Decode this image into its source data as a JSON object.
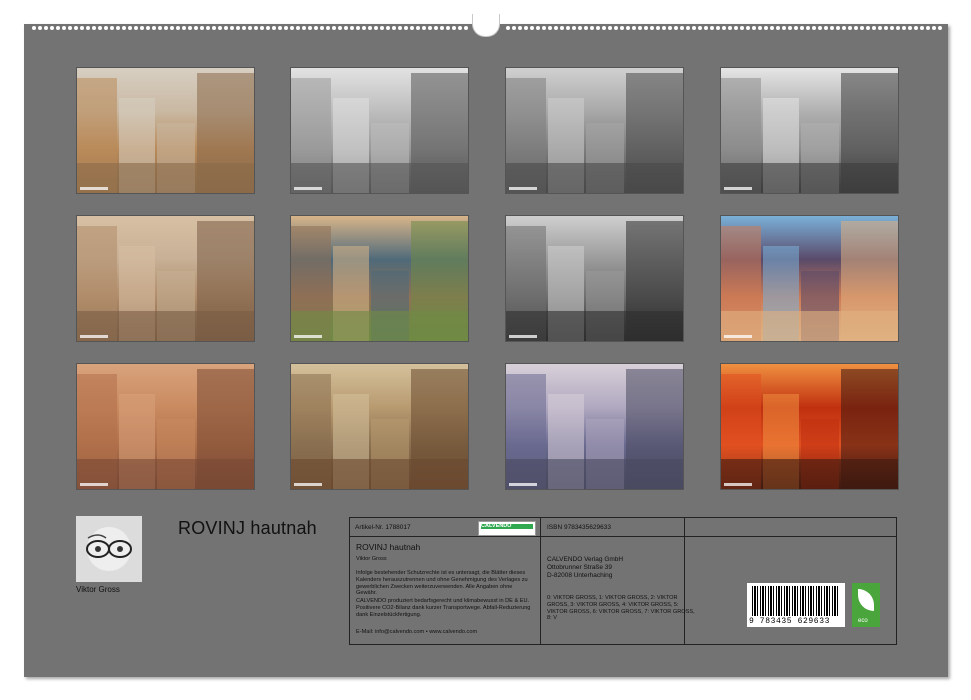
{
  "calendar": {
    "title": "ROVINJ hautnah",
    "author": "Viktor Gross",
    "thumbnails": [
      {
        "name": "thumb-harbour-boats",
        "colors": [
          "#b98a5a",
          "#d7cfc2",
          "#8a6a4a",
          "#c9b8a2"
        ]
      },
      {
        "name": "thumb-cyclist-street",
        "colors": [
          "#9a9a9a",
          "#e2e2e2",
          "#555555",
          "#bdbdbd"
        ]
      },
      {
        "name": "thumb-shop-alley",
        "colors": [
          "#7d7d7d",
          "#d0d0d0",
          "#4a4a4a",
          "#a8a8a8"
        ]
      },
      {
        "name": "thumb-gallery-wall",
        "colors": [
          "#8c8c8c",
          "#e5e5e5",
          "#3e3e3e",
          "#b0b0b0"
        ]
      },
      {
        "name": "thumb-wall-plaque",
        "colors": [
          "#b08c6a",
          "#d8c0a4",
          "#7a5d45",
          "#c7b095"
        ]
      },
      {
        "name": "thumb-child-tricycle",
        "colors": [
          "#8f7055",
          "#d7b489",
          "#6f8a45",
          "#4f6a7a"
        ]
      },
      {
        "name": "thumb-crowd-square",
        "colors": [
          "#6e6e6e",
          "#cfcfcf",
          "#2e2e2e",
          "#9a9a9a"
        ]
      },
      {
        "name": "thumb-colourful-houses",
        "colors": [
          "#cc7a55",
          "#7ab0d8",
          "#e0b080",
          "#5a4a6a"
        ]
      },
      {
        "name": "thumb-arch-lane",
        "colors": [
          "#b0704a",
          "#d9a37c",
          "#7a4a35",
          "#c98a60"
        ]
      },
      {
        "name": "thumb-wishing-wall",
        "colors": [
          "#8a7050",
          "#d4c19c",
          "#6a4a30",
          "#b89a70"
        ]
      },
      {
        "name": "thumb-church-tower",
        "colors": [
          "#6a6a90",
          "#d8d0d8",
          "#4a4a60",
          "#b0a8c0"
        ]
      },
      {
        "name": "thumb-sunset-sea",
        "colors": [
          "#e05020",
          "#f09040",
          "#401a10",
          "#c03010"
        ]
      }
    ]
  },
  "info": {
    "article": "Artikel-Nr. 1788017",
    "logo": "CALVENDO",
    "isbn": "ISBN 9783435629633",
    "book_title": "ROVINJ hautnah",
    "book_author": "Viktor Gross",
    "copyright_note": "Infolge bestehender Schutzrechte ist es untersagt, die Blätter dieses Kalenders herauszutrennen und ohne Genehmigung des Verlages zu gewerblichen Zwecken weiterzuverwenden. Alle Angaben ohne Gewähr.",
    "production_note": "CALVENDO produziert bedarfsgerecht und klimabewusst in DE & EU. Positivere CO2-Bilanz dank kurzer Transportwege. Abfall-Reduzierung dank Einzelstückfertigung.",
    "contact": "E-Mail: info@calvendo.com • www.calvendo.com",
    "publisher": [
      "CALVENDO Verlag GmbH",
      "Ottobrunner Straße 39",
      "D-82008 Unterhaching"
    ],
    "credits": "0: VIKTOR GROSS, 1: VIKTOR GROSS, 2: VIKTOR GROSS, 3: VIKTOR GROSS, 4: VIKTOR GROSS, 5: VIKTOR GROSS, 6: VIKTOR GROSS, 7: VIKTOR GROSS, 8: V",
    "barcode_number": "9 783435 629633",
    "eco_label": "eco"
  }
}
